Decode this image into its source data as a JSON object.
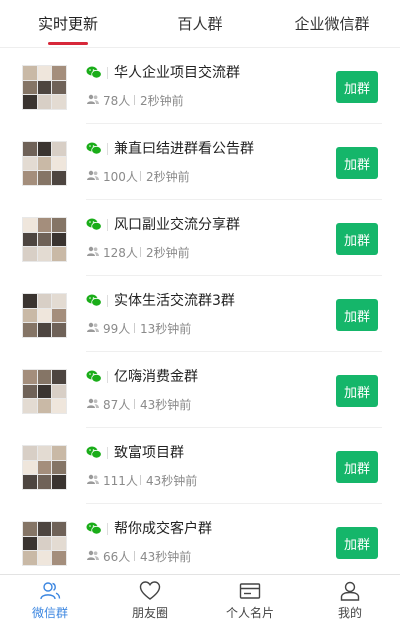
{
  "tabs": [
    {
      "label": "实时更新",
      "active": true
    },
    {
      "label": "百人群",
      "active": false
    },
    {
      "label": "企业微信群",
      "active": false
    }
  ],
  "groups": [
    {
      "name": "华人企业项目交流群",
      "members": "78人",
      "time": "2秒钟前",
      "button": "加群"
    },
    {
      "name": "兼直曰结进群看公告群",
      "members": "100人",
      "time": "2秒钟前",
      "button": "加群"
    },
    {
      "name": "风口副业交流分享群",
      "members": "128人",
      "time": "2秒钟前",
      "button": "加群"
    },
    {
      "name": "实体生活交流群3群",
      "members": "99人",
      "time": "13秒钟前",
      "button": "加群"
    },
    {
      "name": "亿嗨消费金群",
      "members": "87人",
      "time": "43秒钟前",
      "button": "加群"
    },
    {
      "name": "致富项目群",
      "members": "111人",
      "time": "43秒钟前",
      "button": "加群"
    },
    {
      "name": "帮你成交客户群",
      "members": "66人",
      "time": "43秒钟前",
      "button": "加群"
    }
  ],
  "bottom_nav": [
    {
      "label": "微信群",
      "icon": "people-icon",
      "active": true
    },
    {
      "label": "朋友圈",
      "icon": "heart-icon",
      "active": false
    },
    {
      "label": "个人名片",
      "icon": "card-icon",
      "active": false
    },
    {
      "label": "我的",
      "icon": "person-icon",
      "active": false
    }
  ],
  "colors": {
    "accent_red": "#d7283a",
    "join_green": "#15b66a",
    "wechat_green": "#1aad19",
    "nav_active_blue": "#3b86e0"
  }
}
